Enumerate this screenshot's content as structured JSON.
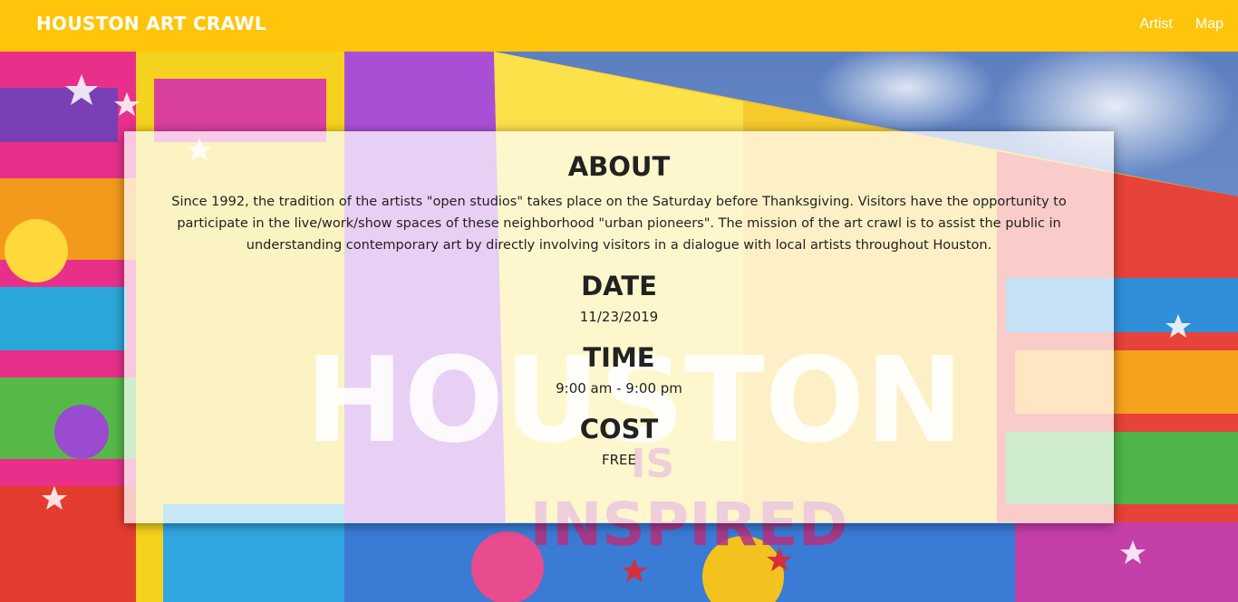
{
  "navbar": {
    "brand": "HOUSTON ART CRAWL",
    "links": [
      {
        "label": "Artist"
      },
      {
        "label": "Map"
      }
    ],
    "background_color": "#fec50a"
  },
  "hero": {
    "image": "houston-is-inspired-mural",
    "mural_words": [
      "HOUSTON",
      "IS",
      "INSPIRED"
    ]
  },
  "info": {
    "about": {
      "heading": "ABOUT",
      "text": "Since 1992, the tradition of the artists \"open studios\" takes place on the Saturday before Thanksgiving. Visitors have the opportunity to participate in the live/work/show spaces of these neighborhood \"urban pioneers\". The mission of the art crawl is to assist the public in understanding contemporary art by directly involving visitors in a dialogue with local artists throughout Houston."
    },
    "date": {
      "heading": "DATE",
      "value": "11/23/2019"
    },
    "time": {
      "heading": "TIME",
      "value": "9:00 am - 9:00 pm"
    },
    "cost": {
      "heading": "COST",
      "value": "FREE"
    }
  }
}
